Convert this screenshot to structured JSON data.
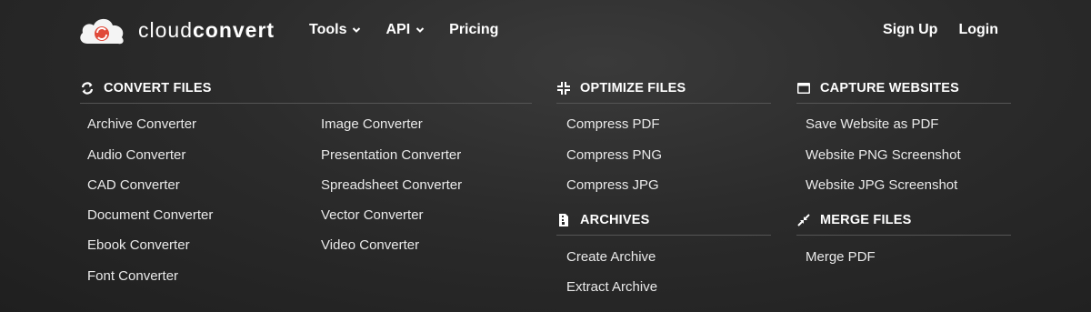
{
  "header": {
    "brand_light": "cloud",
    "brand_bold": "convert",
    "nav": [
      {
        "label": "Tools"
      },
      {
        "label": "API"
      },
      {
        "label": "Pricing"
      }
    ],
    "auth": {
      "signup": "Sign Up",
      "login": "Login"
    }
  },
  "menu": {
    "convert": {
      "title": "CONVERT FILES",
      "col1": [
        "Archive Converter",
        "Audio Converter",
        "CAD Converter",
        "Document Converter",
        "Ebook Converter",
        "Font Converter"
      ],
      "col2": [
        "Image Converter",
        "Presentation Converter",
        "Spreadsheet Converter",
        "Vector Converter",
        "Video Converter"
      ]
    },
    "optimize": {
      "title": "OPTIMIZE FILES",
      "items": [
        "Compress PDF",
        "Compress PNG",
        "Compress JPG"
      ]
    },
    "archives": {
      "title": "ARCHIVES",
      "items": [
        "Create Archive",
        "Extract Archive"
      ]
    },
    "capture": {
      "title": "CAPTURE WEBSITES",
      "items": [
        "Save Website as PDF",
        "Website PNG Screenshot",
        "Website JPG Screenshot"
      ]
    },
    "merge": {
      "title": "MERGE FILES",
      "items": [
        "Merge PDF"
      ]
    }
  },
  "colors": {
    "brand_red": "#e04a3a",
    "background": "#2b2b2b",
    "rule": "#555555"
  }
}
